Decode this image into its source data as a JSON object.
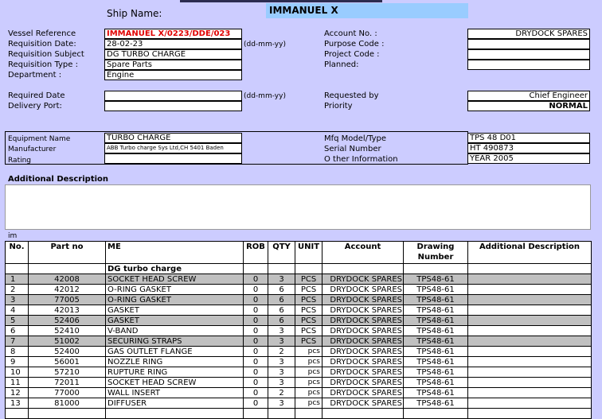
{
  "header": {
    "ship_name_label": "Ship Name:",
    "ship_name_value": "IMMANUEL X"
  },
  "left_fields": {
    "vessel_reference_label": "Vessel Reference",
    "vessel_reference_value": "IMMANUEL X/0223/DDE/023",
    "requisition_date_label": "Requisition Date:",
    "requisition_date_value": "28-02-23",
    "date_format_hint": "(dd-mm-yy)",
    "requisition_subject_label": "Requisition Subject",
    "requisition_subject_value": "DG TURBO CHARGE",
    "requisition_type_label": "Requisition Type :",
    "requisition_type_value": "Spare Parts",
    "department_label": "Department :",
    "department_value": "Engine",
    "required_date_label": "Required Date",
    "required_date_value": "",
    "required_date_hint": "(dd-mm-yy)",
    "delivery_port_label": "Delivery Port:",
    "delivery_port_value": ""
  },
  "right_fields": {
    "account_no_label": "Account No. :",
    "account_no_value": "DRYDOCK SPARES",
    "purpose_code_label": "Purpose Code :",
    "purpose_code_value": "",
    "project_code_label": "Project Code :",
    "project_code_value": "",
    "planned_label": "Planned:",
    "planned_value": "",
    "requested_by_label": "Requested by",
    "requested_by_value": "Chief Engineer",
    "priority_label": "Priority",
    "priority_value": "NORMAL"
  },
  "equipment": {
    "equipment_name_label": "Equipment Name",
    "equipment_name_value": "TURBO CHARGE",
    "manufacturer_label": "Manufacturer",
    "manufacturer_value": "ABB Turbo charge Sys Ltd,CH 5401 Baden",
    "rating_label": "Rating",
    "rating_value": "",
    "model_type_label": "Mfq Model/Type",
    "model_type_value": "TPS 48 D01",
    "serial_number_label": "Serial Number",
    "serial_number_value": "HT 490873",
    "other_info_label": "O ther Information",
    "other_info_value": "YEAR 2005"
  },
  "additional_description": {
    "label": "Additional Description",
    "value": "",
    "stray_text": "im"
  },
  "table": {
    "headers": {
      "no": "No.",
      "part_no": "Part no",
      "me": "ME",
      "rob": "ROB",
      "qty": "QTY",
      "unit": "UNIT",
      "account": "Account",
      "drawing_number": "Drawing Number",
      "additional_description": "Additional Description"
    },
    "group_title": "DG turbo charge",
    "rows": [
      {
        "no": "1",
        "part": "42008",
        "me": "SOCKET HEAD SCREW",
        "rob": "0",
        "qty": "3",
        "unit": "PCS",
        "account": "DRYDOCK SPARES",
        "drawing": "TPS48-61",
        "desc": ""
      },
      {
        "no": "2",
        "part": "42012",
        "me": "O-RING GASKET",
        "rob": "0",
        "qty": "6",
        "unit": "PCS",
        "account": "DRYDOCK SPARES",
        "drawing": "TPS48-61",
        "desc": ""
      },
      {
        "no": "3",
        "part": "77005",
        "me": "O-RING GASKET",
        "rob": "0",
        "qty": "6",
        "unit": "PCS",
        "account": "DRYDOCK SPARES",
        "drawing": "TPS48-61",
        "desc": ""
      },
      {
        "no": "4",
        "part": "42013",
        "me": "GASKET",
        "rob": "0",
        "qty": "6",
        "unit": "PCS",
        "account": "DRYDOCK SPARES",
        "drawing": "TPS48-61",
        "desc": ""
      },
      {
        "no": "5",
        "part": "52406",
        "me": "GASKET",
        "rob": "0",
        "qty": "6",
        "unit": "PCS",
        "account": "DRYDOCK SPARES",
        "drawing": "TPS48-61",
        "desc": ""
      },
      {
        "no": "6",
        "part": "52410",
        "me": "V-BAND",
        "rob": "0",
        "qty": "3",
        "unit": "PCS",
        "account": "DRYDOCK SPARES",
        "drawing": "TPS48-61",
        "desc": ""
      },
      {
        "no": "7",
        "part": "51002",
        "me": "SECURING STRAPS",
        "rob": "0",
        "qty": "3",
        "unit": "PCS",
        "account": "DRYDOCK SPARES",
        "drawing": "TPS48-61",
        "desc": ""
      },
      {
        "no": "8",
        "part": "52400",
        "me": "GAS OUTLET FLANGE",
        "rob": "0",
        "qty": "2",
        "unit": "pcs",
        "account": "DRYDOCK SPARES",
        "drawing": "TPS48-61",
        "desc": ""
      },
      {
        "no": "9",
        "part": "56001",
        "me": "NOZZLE RING",
        "rob": "0",
        "qty": "3",
        "unit": "pcs",
        "account": "DRYDOCK SPARES",
        "drawing": "TPS48-61",
        "desc": ""
      },
      {
        "no": "10",
        "part": "57210",
        "me": "RUPTURE RING",
        "rob": "0",
        "qty": "3",
        "unit": "pcs",
        "account": "DRYDOCK SPARES",
        "drawing": "TPS48-61",
        "desc": ""
      },
      {
        "no": "11",
        "part": "72011",
        "me": "SOCKET HEAD SCREW",
        "rob": "0",
        "qty": "3",
        "unit": "pcs",
        "account": "DRYDOCK SPARES",
        "drawing": "TPS48-61",
        "desc": ""
      },
      {
        "no": "12",
        "part": "77000",
        "me": "WALL INSERT",
        "rob": "0",
        "qty": "2",
        "unit": "pcs",
        "account": "DRYDOCK SPARES",
        "drawing": "TPS48-61",
        "desc": ""
      },
      {
        "no": "13",
        "part": "81000",
        "me": "DIFFUSER",
        "rob": "0",
        "qty": "3",
        "unit": "pcs",
        "account": "DRYDOCK SPARES",
        "drawing": "TPS48-61",
        "desc": ""
      }
    ]
  }
}
